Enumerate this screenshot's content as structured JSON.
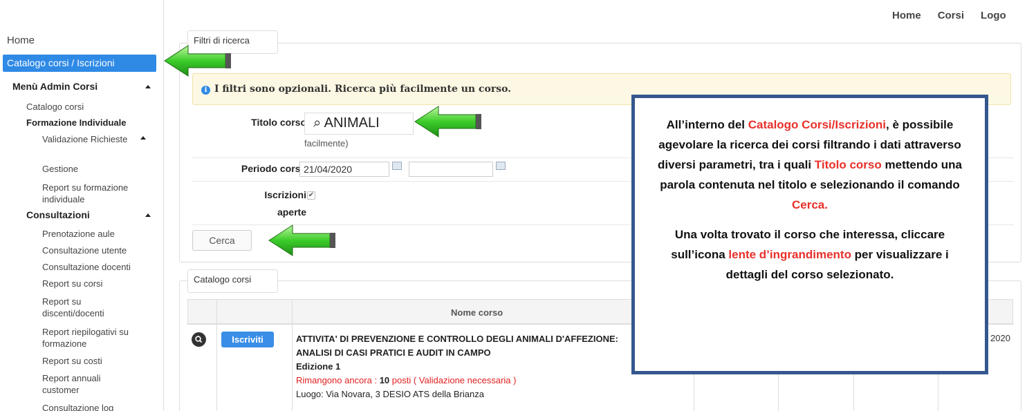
{
  "topnav": {
    "home": "Home",
    "corsi": "Corsi",
    "logout": "Logo"
  },
  "sidebar": {
    "home": "Home",
    "active": "Catalogo corsi / Iscrizioni",
    "admin_group": "Menù Admin Corsi",
    "catalogo_corsi": "Catalogo corsi",
    "formazione_individuale": "Formazione Individuale",
    "validazione": "Validazione Richieste",
    "gestione": "Gestione",
    "report_formazione": "Report su formazione individuale",
    "consultazioni": "Consultazioni",
    "prenotazione": "Prenotazione aule",
    "cons_utente": "Consultazione utente",
    "cons_docenti": "Consultazione docenti",
    "report_corsi": "Report su corsi",
    "report_discenti": "Report su discenti/docenti",
    "report_riepilogativi": "Report riepilogativi su formazione",
    "report_costi": "Report su costi",
    "report_annuali": "Report annuali customer",
    "cons_log": "Consultazione log"
  },
  "filters": {
    "legend": "Filtri di ricerca",
    "alert": "I filtri sono opzionali. Ricerca più facilmente un corso.",
    "titolo_label": "Titolo corso",
    "titolo_value": "⌕ ANIMALI",
    "titolo_hint": "facilmente)",
    "periodo_label": "Periodo corso",
    "periodo_from": "21/04/2020",
    "periodo_to": "",
    "iscrizioni_label_1": "Iscrizioni",
    "iscrizioni_label_2": "aperte",
    "iscrizioni_checked": "✔",
    "cerca": "Cerca"
  },
  "catalog": {
    "legend": "Catalogo corsi",
    "col_nome": "Nome corso",
    "iscriviti": "Iscriviti",
    "course_name": "ATTIVITA' DI PREVENZIONE E CONTROLLO DEGLI ANIMALI D'AFFEZIONE: ANALISI DI CASI PRATICI E AUDIT IN CAMPO",
    "edizione": "Edizione 1",
    "rimangono_prefix": "Rimangono ancora : ",
    "posti_count": "10",
    "rimangono_suffix": " posti ( Validazione necessaria )",
    "luogo": "Luogo: Via Novara, 3 DESIO ATS della Brianza",
    "year_fragment": "2020"
  },
  "callout": {
    "p1_a": "All’interno del ",
    "p1_hl1": "Catalogo Corsi/Iscrizioni",
    "p1_b": ", è possibile agevolare la ricerca dei corsi filtrando i dati attraverso diversi parametri, tra i quali ",
    "p1_hl2": "Titolo corso",
    "p1_c": " mettendo una parola contenuta nel titolo e selezionando il comando ",
    "p1_hl3": "Cerca.",
    "p2_a": "Una volta trovato il corso che interessa, cliccare sull’icona ",
    "p2_hl": "lente d’ingrandimento",
    "p2_b": " per visualizzare i dettagli del corso selezionato."
  },
  "colors": {
    "accent": "#2f8ae6",
    "highlight": "#e8302a",
    "callout_border": "#35578f",
    "arrow": "#3ccc2a"
  }
}
